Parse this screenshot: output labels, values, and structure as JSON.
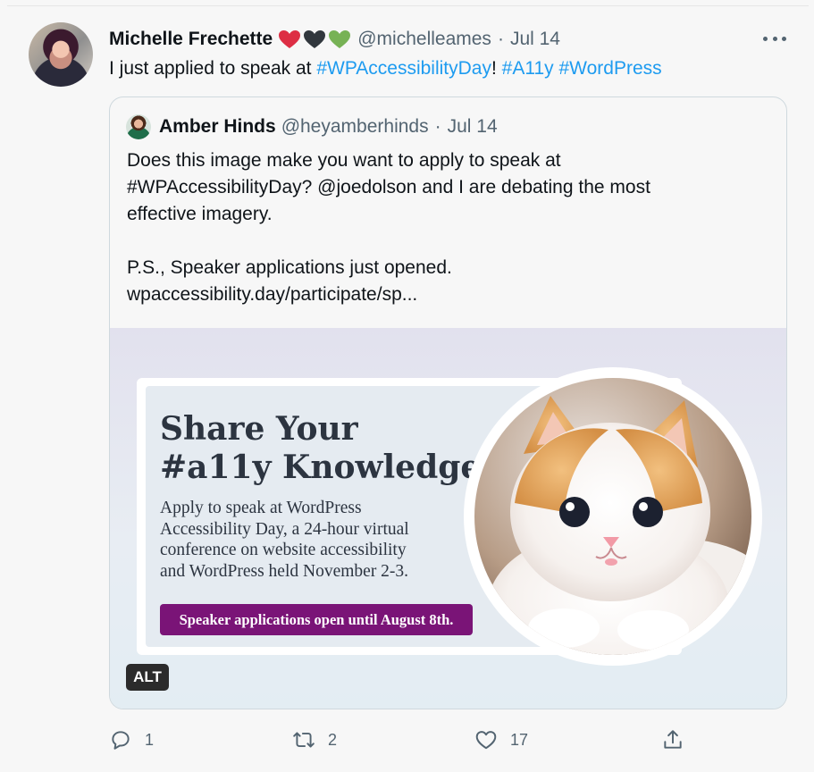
{
  "tweet": {
    "author_name": "Michelle Frechette",
    "hearts": [
      "red-heart-emoji",
      "black-heart-emoji",
      "green-heart-emoji"
    ],
    "handle": "@michelleames",
    "separator": "·",
    "date": "Jul 14",
    "text_prefix": "I just applied to speak at ",
    "hashtag1": "#WPAccessibilityDay",
    "text_mid": "! ",
    "hashtag2": "#A11y",
    "text_space": " ",
    "hashtag3": "#WordPress"
  },
  "quote": {
    "author_name": "Amber Hinds",
    "handle": "@heyamberhinds",
    "separator": "·",
    "date": "Jul 14",
    "lines": [
      "Does this image make you want to apply to speak at",
      "#WPAccessibilityDay? @joedolson and I are debating the most",
      "effective imagery.",
      "",
      "P.S., Speaker applications just opened.",
      "wpaccessibility.day/participate/sp..."
    ],
    "image": {
      "title_lines": [
        "Share Your",
        "#a11y Knowledge"
      ],
      "body_lines": [
        "Apply to speak at WordPress",
        "Accessibility Day, a 24-hour virtual",
        "conference on website accessibility",
        "and WordPress held November 2-3."
      ],
      "cta": "Speaker applications open until August 8th.",
      "alt_badge": "ALT"
    }
  },
  "actions": {
    "reply_count": "1",
    "retweet_count": "2",
    "like_count": "17"
  },
  "colors": {
    "link": "#1d9bf0",
    "muted": "#536471",
    "cta_purple": "#7a1477"
  }
}
